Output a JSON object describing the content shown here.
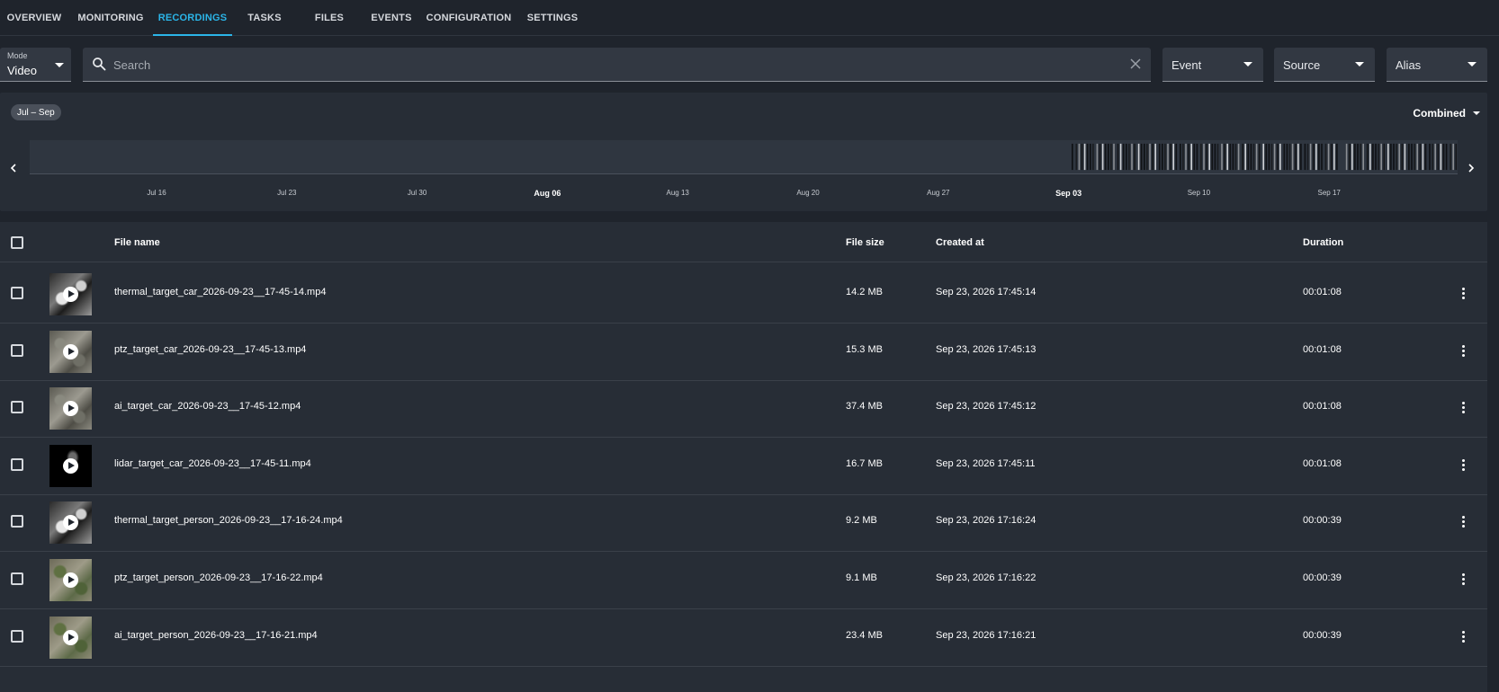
{
  "nav": {
    "tabs": [
      {
        "label": "OVERVIEW",
        "active": false
      },
      {
        "label": "MONITORING",
        "active": false
      },
      {
        "label": "RECORDINGS",
        "active": true
      },
      {
        "label": "TASKS",
        "active": false
      },
      {
        "label": "FILES",
        "active": false
      },
      {
        "label": "EVENTS",
        "active": false
      },
      {
        "label": "CONFIGURATION",
        "active": false
      },
      {
        "label": "SETTINGS",
        "active": false
      }
    ],
    "accent_color": "#2bb5e8"
  },
  "filters": {
    "mode": {
      "label": "Mode",
      "value": "Video"
    },
    "search": {
      "placeholder": "Search",
      "value": ""
    },
    "event": {
      "label": "Event"
    },
    "source": {
      "label": "Source"
    },
    "alias": {
      "label": "Alias"
    }
  },
  "timeline": {
    "range_chip": "Jul – Sep",
    "view_select": "Combined",
    "axis_labels": [
      {
        "label": "Jul 16",
        "major": false
      },
      {
        "label": "Jul 23",
        "major": false
      },
      {
        "label": "Jul 30",
        "major": false
      },
      {
        "label": "Aug 06",
        "major": true
      },
      {
        "label": "Aug 13",
        "major": false
      },
      {
        "label": "Aug 20",
        "major": false
      },
      {
        "label": "Aug 27",
        "major": false
      },
      {
        "label": "Sep 03",
        "major": true
      },
      {
        "label": "Sep 10",
        "major": false
      },
      {
        "label": "Sep 17",
        "major": false
      }
    ]
  },
  "table": {
    "columns": {
      "file_name": "File name",
      "file_size": "File size",
      "created_at": "Created at",
      "duration": "Duration"
    },
    "rows": [
      {
        "file_name": "thermal_target_car_2026-09-23__17-45-14.mp4",
        "file_size": "14.2 MB",
        "created_at": "Sep 23, 2026 17:45:14",
        "duration": "00:01:08",
        "thumb": "thermal"
      },
      {
        "file_name": "ptz_target_car_2026-09-23__17-45-13.mp4",
        "file_size": "15.3 MB",
        "created_at": "Sep 23, 2026 17:45:13",
        "duration": "00:01:08",
        "thumb": "aerial"
      },
      {
        "file_name": "ai_target_car_2026-09-23__17-45-12.mp4",
        "file_size": "37.4 MB",
        "created_at": "Sep 23, 2026 17:45:12",
        "duration": "00:01:08",
        "thumb": "aerial"
      },
      {
        "file_name": "lidar_target_car_2026-09-23__17-45-11.mp4",
        "file_size": "16.7 MB",
        "created_at": "Sep 23, 2026 17:45:11",
        "duration": "00:01:08",
        "thumb": "lidar"
      },
      {
        "file_name": "thermal_target_person_2026-09-23__17-16-24.mp4",
        "file_size": "9.2 MB",
        "created_at": "Sep 23, 2026 17:16:24",
        "duration": "00:00:39",
        "thumb": "thermal"
      },
      {
        "file_name": "ptz_target_person_2026-09-23__17-16-22.mp4",
        "file_size": "9.1 MB",
        "created_at": "Sep 23, 2026 17:16:22",
        "duration": "00:00:39",
        "thumb": "aerial-green"
      },
      {
        "file_name": "ai_target_person_2026-09-23__17-16-21.mp4",
        "file_size": "23.4 MB",
        "created_at": "Sep 23, 2026 17:16:21",
        "duration": "00:00:39",
        "thumb": "aerial-green"
      }
    ]
  }
}
